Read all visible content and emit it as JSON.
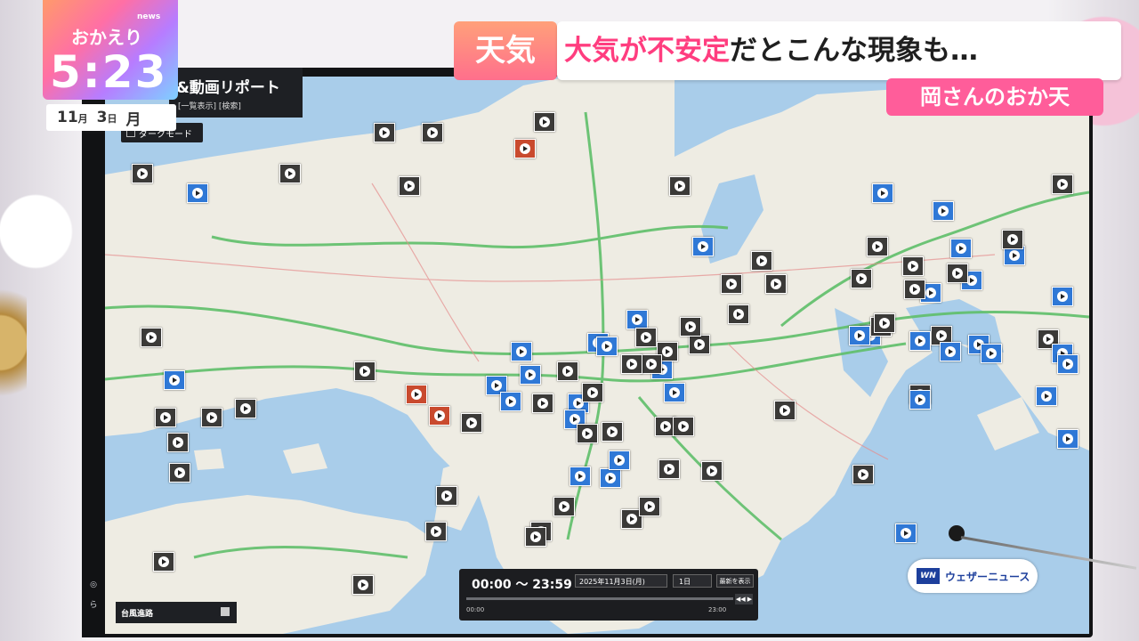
{
  "broadcast": {
    "program_news_label": "news",
    "program_name": "おかえり",
    "time": "5:23",
    "date": {
      "month": "11",
      "month_unit": "月",
      "day": "3",
      "day_unit": "日",
      "weekday": "月"
    },
    "headline_tag": "天気",
    "headline_highlight": "大気が不安定",
    "headline_rest": "だとこんな現象も…",
    "corner_title": "岡さんのおか天"
  },
  "app": {
    "title": "&動画リポート",
    "subtitle": "[一覧表示] [検索]",
    "dark_mode_label": "ダークモード",
    "typhoon_label": "台風進路",
    "rail_label": "ら",
    "brand": "ウェザーニュース",
    "brand_mark": "WN",
    "timebar": {
      "range": "00:00 〜 23:59",
      "date": "2025年11月3日(月)",
      "days": "1日",
      "latest_button": "最新を表示",
      "start": "00:00",
      "end": "23:00",
      "nav": "◀◀ ▶"
    }
  },
  "colors": {
    "sea": "#a9cdea",
    "land": "#eeece3",
    "road": "#5fbf6a",
    "accent_pink": "#ff3d7f",
    "marker_blue": "#2f78d6"
  }
}
